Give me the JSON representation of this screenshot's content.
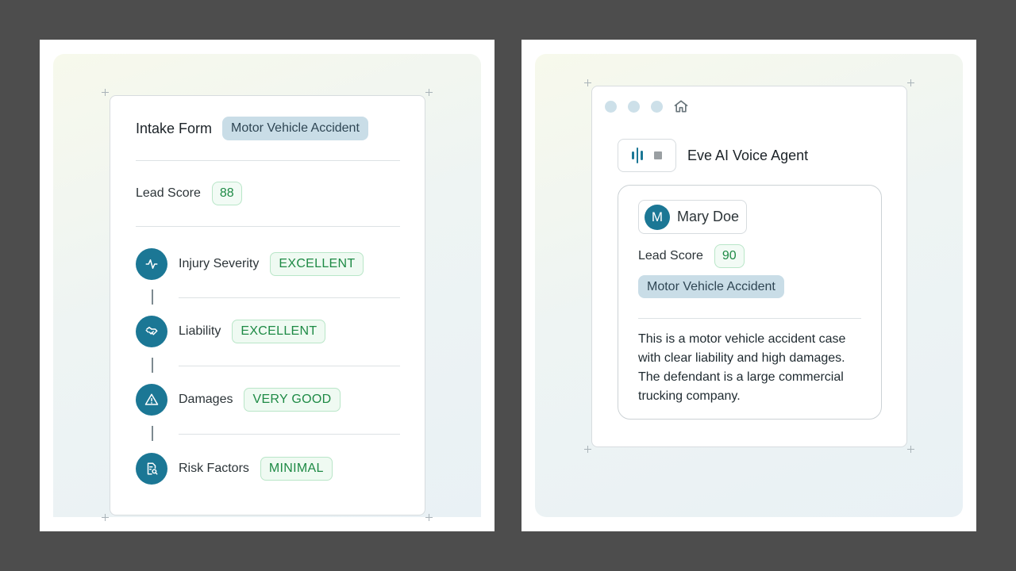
{
  "intake": {
    "title": "Intake Form",
    "case_type": "Motor Vehicle Accident",
    "lead_score_label": "Lead Score",
    "lead_score": "88",
    "criteria": [
      {
        "label": "Injury Severity",
        "rating": "EXCELLENT",
        "icon": "pulse-icon"
      },
      {
        "label": "Liability",
        "rating": "EXCELLENT",
        "icon": "handshake-icon"
      },
      {
        "label": "Damages",
        "rating": "VERY GOOD",
        "icon": "warning-icon"
      },
      {
        "label": "Risk Factors",
        "rating": "MINIMAL",
        "icon": "document-search-icon"
      }
    ]
  },
  "voice": {
    "agent_title": "Eve AI Voice Agent",
    "person_initial": "M",
    "person_name": "Mary Doe",
    "lead_score_label": "Lead Score",
    "lead_score": "90",
    "case_type": "Motor Vehicle Accident",
    "summary": "This is a motor vehicle accident case with clear liability and high damages. The defendant is a large commercial trucking company."
  },
  "colors": {
    "accent": "#1b7795",
    "tag_bg": "#c9dde7",
    "score_green": "#1e8a45"
  }
}
